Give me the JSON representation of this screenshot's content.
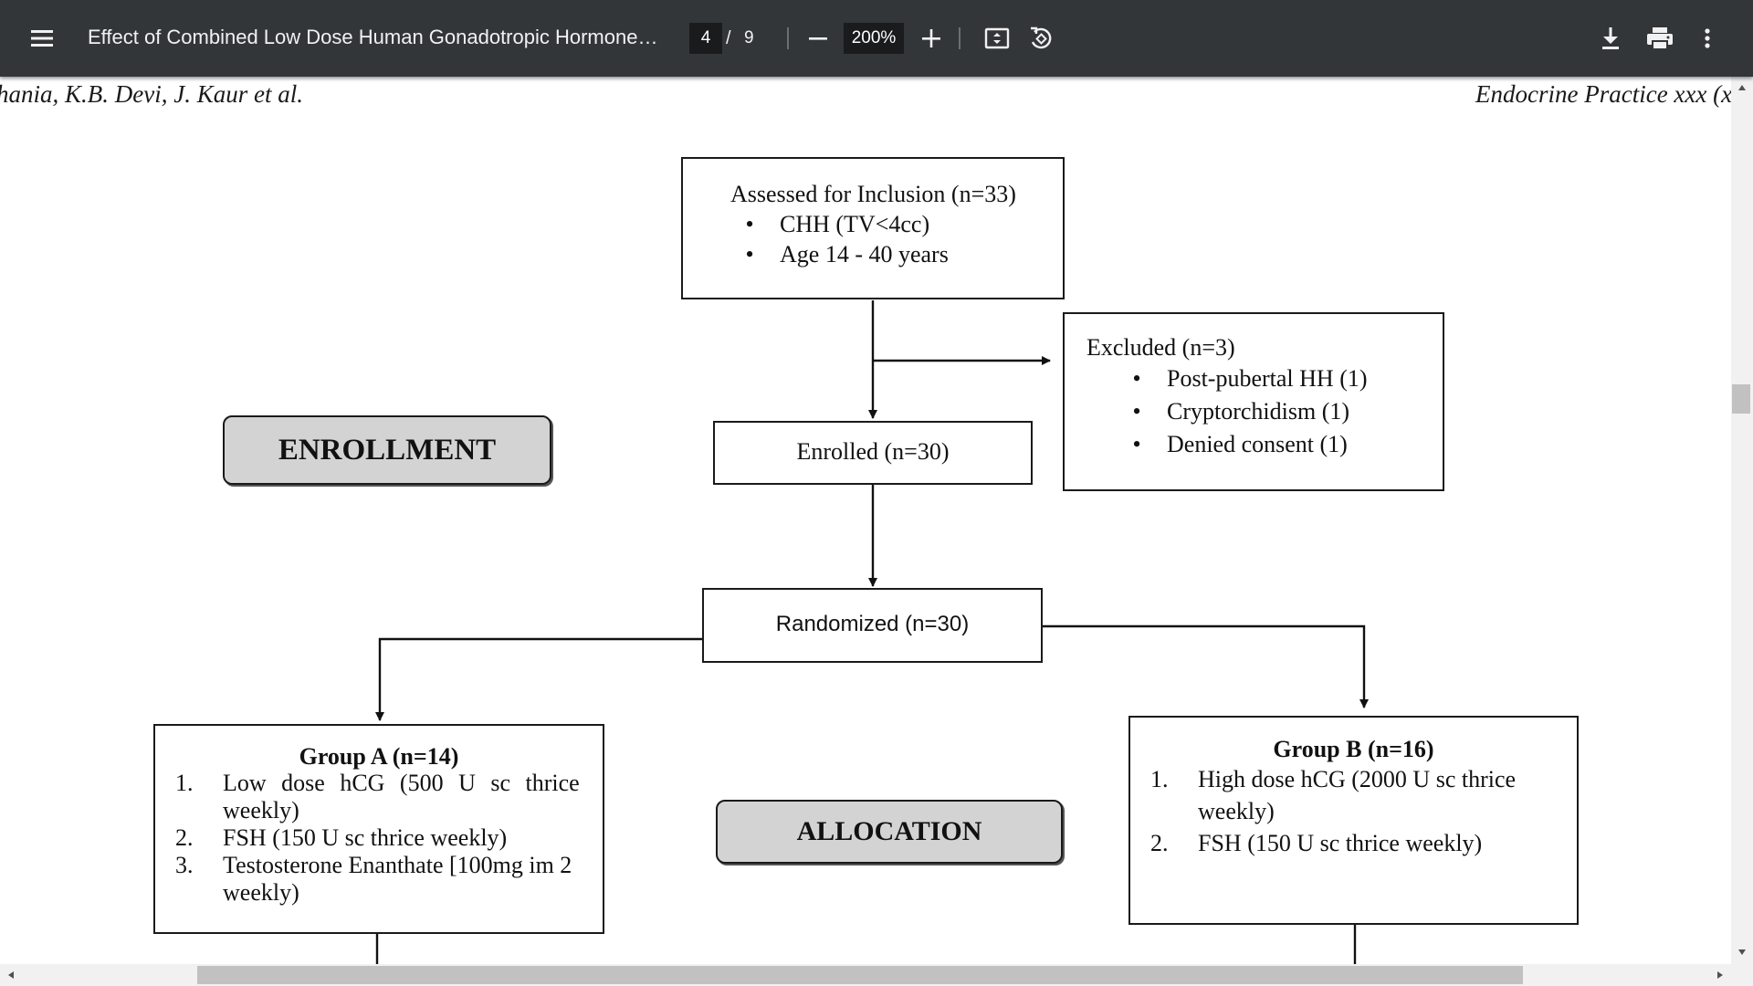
{
  "toolbar": {
    "title": "Effect of Combined Low Dose Human Gonadotropic Hormone , ...",
    "page_current": "4",
    "page_separator": "/",
    "page_total": "9",
    "zoom": "200%"
  },
  "icons": [
    "menu-icon",
    "zoom-out-icon",
    "zoom-in-icon",
    "fit-page-icon",
    "rotate-icon",
    "download-icon",
    "print-icon",
    "more-vert-icon"
  ],
  "page": {
    "running_head_left": "hania, K.B. Devi, J. Kaur et al.",
    "running_head_right": "Endocrine Practice xxx (x",
    "flowchart": {
      "assessed": {
        "title": "Assessed for Inclusion (n=33)",
        "bullets": [
          "CHH (TV<4cc)",
          "Age 14 - 40 years"
        ]
      },
      "excluded": {
        "title": "Excluded (n=3)",
        "bullets": [
          "Post-pubertal HH (1)",
          "Cryptorchidism (1)",
          "Denied consent (1)"
        ]
      },
      "enrollment_label": "ENROLLMENT",
      "enrolled": "Enrolled (n=30)",
      "randomized": "Randomized (n=30)",
      "allocation_label": "ALLOCATION",
      "group_a": {
        "title": "Group A (n=14)",
        "items": [
          {
            "num": "1.",
            "text": "Low dose hCG (500 U sc thrice",
            "cont": "weekly)"
          },
          {
            "num": "2.",
            "text": "FSH (150 U sc thrice weekly)"
          },
          {
            "num": "3.",
            "text": "Testosterone Enanthate [100mg im 2",
            "cont": "weekly)"
          }
        ]
      },
      "group_b": {
        "title": "Group B (n=16)",
        "items": [
          {
            "num": "1.",
            "text": "High dose hCG (2000 U sc thrice",
            "cont": "weekly)"
          },
          {
            "num": "2.",
            "text": "FSH (150 U sc thrice weekly)"
          }
        ]
      }
    }
  }
}
